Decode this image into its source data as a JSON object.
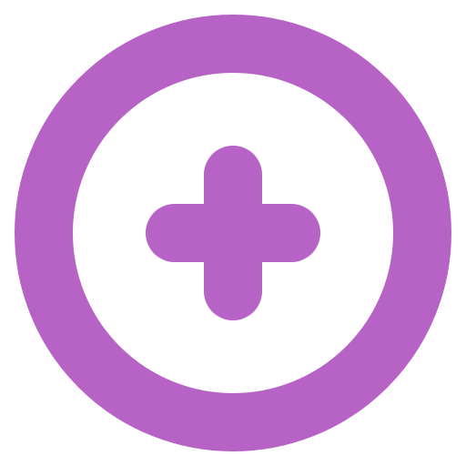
{
  "icon": {
    "name": "add-circle-icon",
    "color": "#b762c5",
    "background": "#ffffff"
  }
}
